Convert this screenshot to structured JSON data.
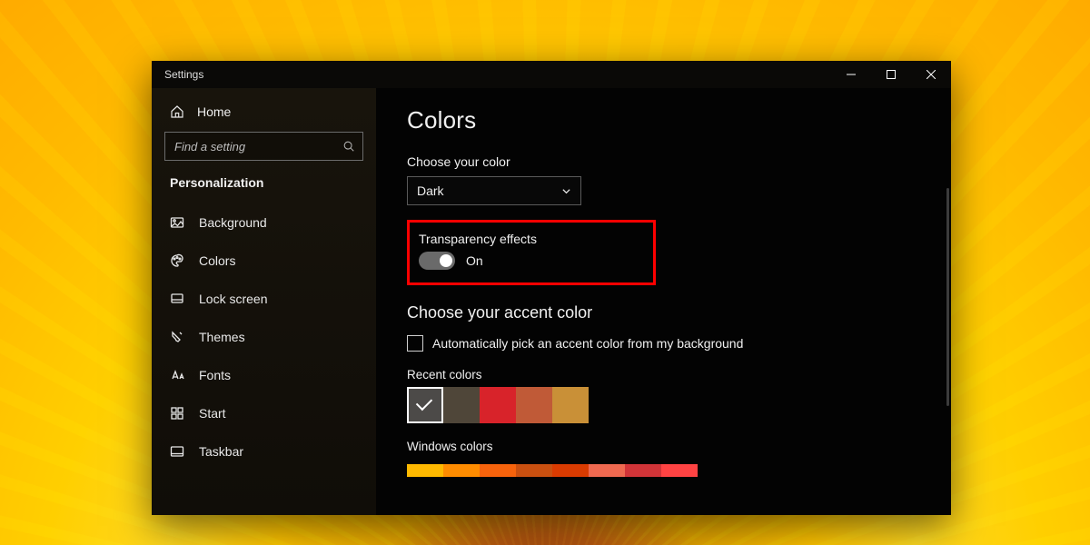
{
  "window": {
    "title": "Settings"
  },
  "sidebar": {
    "home": "Home",
    "search_placeholder": "Find a setting",
    "heading": "Personalization",
    "items": [
      {
        "key": "background",
        "label": "Background"
      },
      {
        "key": "colors",
        "label": "Colors"
      },
      {
        "key": "lockscreen",
        "label": "Lock screen"
      },
      {
        "key": "themes",
        "label": "Themes"
      },
      {
        "key": "fonts",
        "label": "Fonts"
      },
      {
        "key": "start",
        "label": "Start"
      },
      {
        "key": "taskbar",
        "label": "Taskbar"
      }
    ]
  },
  "main": {
    "title": "Colors",
    "choose_color_label": "Choose your color",
    "choose_color_value": "Dark",
    "transparency": {
      "label": "Transparency effects",
      "state": "On"
    },
    "accent_heading": "Choose your accent color",
    "auto_accent_label": "Automatically pick an accent color from my background",
    "recent_label": "Recent colors",
    "recent_colors": [
      "#4c4a48",
      "#4f4639",
      "#d8232a",
      "#c05a37",
      "#c99037"
    ],
    "recent_selected_index": 0,
    "windows_label": "Windows colors",
    "windows_colors": [
      "#ffb900",
      "#ff8c00",
      "#f7630c",
      "#ca5010",
      "#da3b01",
      "#ef6950",
      "#d13438",
      "#ff4343"
    ]
  }
}
